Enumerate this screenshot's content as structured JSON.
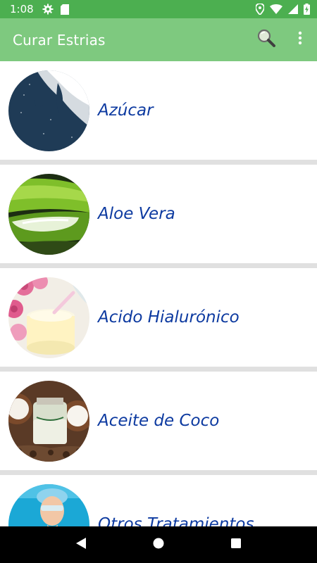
{
  "status_bar": {
    "time": "1:08",
    "icons_left": [
      "gear-icon",
      "sd-card-icon"
    ],
    "icons_right": [
      "location-icon",
      "wifi-icon",
      "signal-icon",
      "battery-charging-icon"
    ]
  },
  "app_bar": {
    "title": "Curar Estrias",
    "actions": [
      "search-icon",
      "more-vert-icon"
    ]
  },
  "list": {
    "items": [
      {
        "label": "Azúcar",
        "image": "sugar-fork-knife-image"
      },
      {
        "label": "Aloe Vera",
        "image": "aloe-vera-image"
      },
      {
        "label": "Acido Hialurónico",
        "image": "cream-jar-roses-image"
      },
      {
        "label": "Aceite de Coco",
        "image": "coconut-oil-image"
      },
      {
        "label": "Otros Tratamientos",
        "image": "doctor-portrait-image"
      }
    ]
  },
  "nav_bar": {
    "buttons": [
      "back-icon",
      "home-icon",
      "recents-icon"
    ]
  },
  "colors": {
    "status_bar": "#4caf50",
    "app_bar": "#7ec97f",
    "item_text": "#0d3aa0",
    "divider": "#e0e0e0",
    "nav_bar": "#000000"
  }
}
